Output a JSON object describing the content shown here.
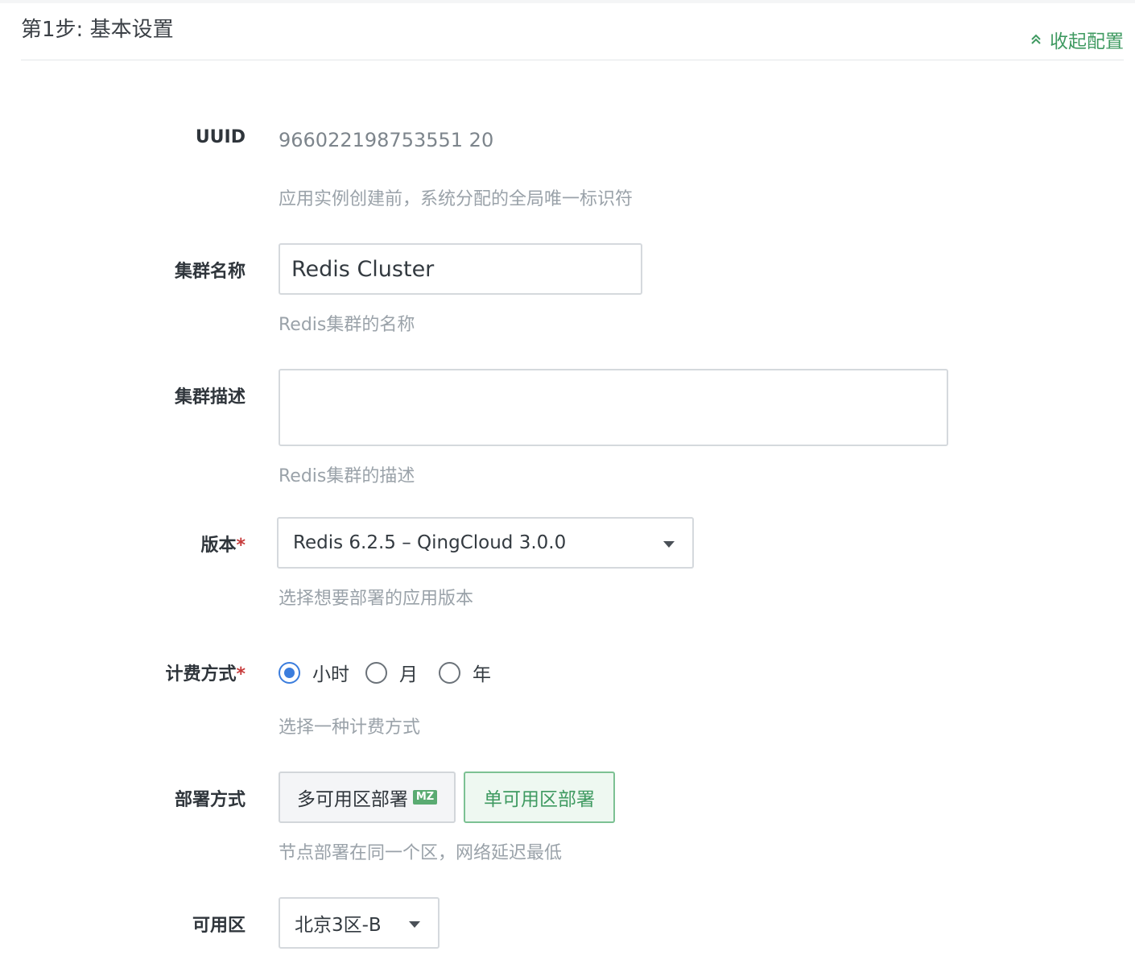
{
  "header": {
    "section_title": "第1步: 基本设置",
    "collapse_label": "收起配置"
  },
  "form": {
    "uuid": {
      "label": "UUID",
      "value": "966022198753551 20",
      "help": "应用实例创建前，系统分配的全局唯一标识符"
    },
    "cluster_name": {
      "label": "集群名称",
      "value": "Redis Cluster",
      "help": "Redis集群的名称"
    },
    "cluster_desc": {
      "label": "集群描述",
      "value": "",
      "help": "Redis集群的描述"
    },
    "version": {
      "label": "版本",
      "required_mark": "*",
      "selected": "Redis 6.2.5 – QingCloud 3.0.0",
      "help": "选择想要部署的应用版本"
    },
    "billing": {
      "label": "计费方式",
      "required_mark": "*",
      "options": [
        "小时",
        "月",
        "年"
      ],
      "selected": "小时",
      "help": "选择一种计费方式"
    },
    "deploy": {
      "label": "部署方式",
      "multi_label": "多可用区部署",
      "multi_badge": "MZ",
      "single_label": "单可用区部署",
      "selected": "单可用区部署",
      "help": "节点部署在同一个区，网络延迟最低"
    },
    "zone": {
      "label": "可用区",
      "selected": "北京3区-B"
    }
  },
  "colors": {
    "accent_green": "#3f9a61",
    "radio_blue": "#3b7ddd",
    "required_red": "#c73b3b"
  }
}
